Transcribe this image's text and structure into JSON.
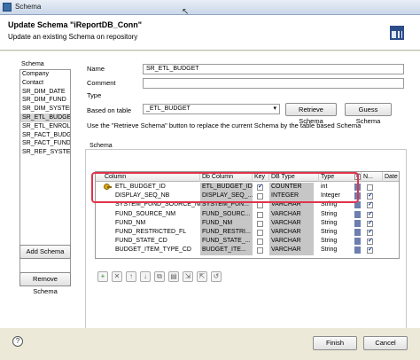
{
  "window": {
    "title": "Schema"
  },
  "header": {
    "title": "Update Schema \"iReportDB_Conn\"",
    "subtitle": "Update an existing Schema on repository"
  },
  "sidebar": {
    "label": "Schema",
    "items": [
      "Company",
      "Contact",
      "SR_DIM_DATE",
      "SR_DIM_FUND",
      "SR_DIM_SYSTEM",
      "SR_ETL_BUDGET",
      "SR_ETL_ENROLL",
      "SR_FACT_BUDGET_",
      "SR_FACT_FUND_SOU",
      "SR_REF_SYSTEM"
    ],
    "selected": "SR_ETL_BUDGET",
    "add_button": "Add Schema",
    "remove_button": "Remove Schema"
  },
  "form": {
    "name_label": "Name",
    "name_value": "SR_ETL_BUDGET",
    "comment_label": "Comment",
    "type_label": "Type",
    "table_label": "Based on table",
    "table_value": "_ETL_BUDGET",
    "retrieve_button": "Retrieve Schema",
    "guess_button": "Guess Schema",
    "hint": "Use the \"Retrieve Schema\" button to replace the current Schema by the table based Schema"
  },
  "schema_group": {
    "label": "Schema",
    "columns": [
      "Column",
      "Db Column",
      "Key",
      "DB Type",
      "Type",
      "N...",
      "Date P"
    ],
    "rows": [
      {
        "column": "ETL_BUDGET_ID",
        "db_column": "ETL_BUDGET_ID",
        "key": true,
        "db_type": "COUNTER",
        "type": "int",
        "nullable": false,
        "is_key_icon": true
      },
      {
        "column": "DISPLAY_SEQ_NB",
        "db_column": "DISPLAY_SEQ_...",
        "key": false,
        "db_type": "INTEGER",
        "type": "Integer",
        "nullable": true,
        "is_key_icon": false
      },
      {
        "column": "SYSTEM_FUND_SOURCE_NM",
        "db_column": "SYSTEM_FUN...",
        "key": false,
        "db_type": "VARCHAR",
        "type": "String",
        "nullable": true,
        "is_key_icon": false
      },
      {
        "column": "FUND_SOURCE_NM",
        "db_column": "FUND_SOURC...",
        "key": false,
        "db_type": "VARCHAR",
        "type": "String",
        "nullable": true,
        "is_key_icon": false
      },
      {
        "column": "FUND_NM",
        "db_column": "FUND_NM",
        "key": false,
        "db_type": "VARCHAR",
        "type": "String",
        "nullable": true,
        "is_key_icon": false
      },
      {
        "column": "FUND_RESTRICTED_FL",
        "db_column": "FUND_RESTRI...",
        "key": false,
        "db_type": "VARCHAR",
        "type": "String",
        "nullable": true,
        "is_key_icon": false
      },
      {
        "column": "FUND_STATE_CD",
        "db_column": "FUND_STATE_...",
        "key": false,
        "db_type": "VARCHAR",
        "type": "String",
        "nullable": true,
        "is_key_icon": false
      },
      {
        "column": "BUDGET_ITEM_TYPE_CD",
        "db_column": "BUDGET_ITE...",
        "key": false,
        "db_type": "VARCHAR",
        "type": "String",
        "nullable": true,
        "is_key_icon": false
      }
    ],
    "toolbar_icons": [
      "add-row-icon",
      "remove-row-icon",
      "move-up-icon",
      "move-down-icon",
      "copy-icon",
      "paste-icon",
      "import-icon",
      "export-icon",
      "reset-icon"
    ]
  },
  "footer": {
    "finish_button": "Finish",
    "cancel_button": "Cancel"
  },
  "colors": {
    "highlight": "#e0354a",
    "selected_row": "#d7d7d7",
    "db_cell": "#c6c6c6"
  }
}
